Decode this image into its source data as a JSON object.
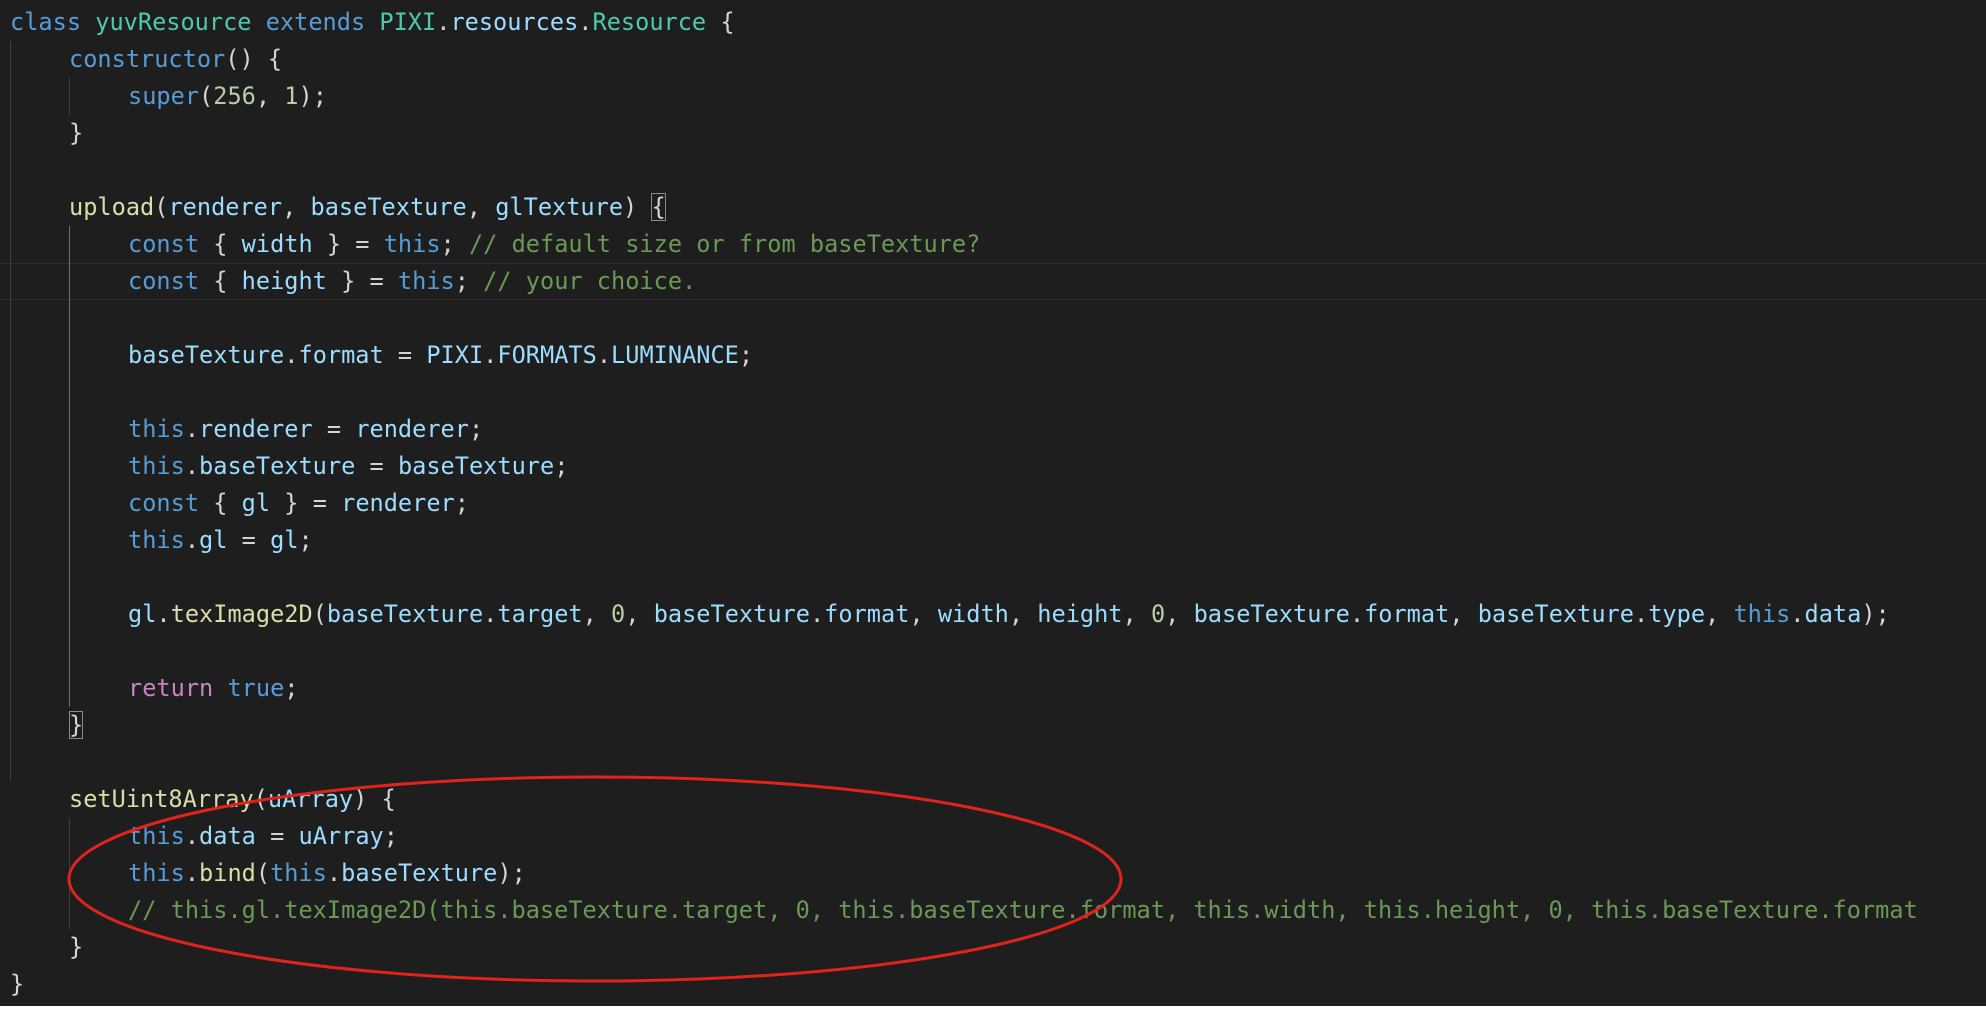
{
  "colors": {
    "background": "#1e1e1e",
    "keyword": "#569cd6",
    "class_name": "#4ec9b0",
    "function": "#dcdcaa",
    "variable": "#9cdcfe",
    "number": "#b5cea8",
    "comment": "#6a9955",
    "control": "#c586c0",
    "annotation": "#e0241b"
  },
  "code": {
    "lines": [
      {
        "indent": 0,
        "tokens": [
          {
            "t": "class",
            "c": "k"
          },
          {
            "t": " "
          },
          {
            "t": "yuvResource",
            "c": "c"
          },
          {
            "t": " "
          },
          {
            "t": "extends",
            "c": "k"
          },
          {
            "t": " "
          },
          {
            "t": "PIXI",
            "c": "c"
          },
          {
            "t": "."
          },
          {
            "t": "resources",
            "c": "v"
          },
          {
            "t": "."
          },
          {
            "t": "Resource",
            "c": "c"
          },
          {
            "t": " {"
          }
        ]
      },
      {
        "indent": 1,
        "tokens": [
          {
            "t": "constructor",
            "c": "k"
          },
          {
            "t": "() {"
          }
        ]
      },
      {
        "indent": 2,
        "tokens": [
          {
            "t": "super",
            "c": "k"
          },
          {
            "t": "("
          },
          {
            "t": "256",
            "c": "n"
          },
          {
            "t": ", "
          },
          {
            "t": "1",
            "c": "n"
          },
          {
            "t": ");"
          }
        ]
      },
      {
        "indent": 1,
        "tokens": [
          {
            "t": "}"
          }
        ]
      },
      {
        "indent": 0,
        "tokens": []
      },
      {
        "indent": 1,
        "tokens": [
          {
            "t": "upload",
            "c": "f"
          },
          {
            "t": "("
          },
          {
            "t": "renderer",
            "c": "v"
          },
          {
            "t": ", "
          },
          {
            "t": "baseTexture",
            "c": "v"
          },
          {
            "t": ", "
          },
          {
            "t": "glTexture",
            "c": "v"
          },
          {
            "t": ") "
          },
          {
            "t": "{",
            "c": "p bm"
          }
        ]
      },
      {
        "indent": 2,
        "tokens": [
          {
            "t": "const",
            "c": "k"
          },
          {
            "t": " { "
          },
          {
            "t": "width",
            "c": "v"
          },
          {
            "t": " } = "
          },
          {
            "t": "this",
            "c": "k"
          },
          {
            "t": "; "
          },
          {
            "t": "// default size or from baseTexture?",
            "c": "m"
          }
        ]
      },
      {
        "indent": 2,
        "current": true,
        "tokens": [
          {
            "t": "const",
            "c": "k"
          },
          {
            "t": " { "
          },
          {
            "t": "height",
            "c": "v"
          },
          {
            "t": " } = "
          },
          {
            "t": "this",
            "c": "k"
          },
          {
            "t": "; "
          },
          {
            "t": "// your choice.",
            "c": "m"
          }
        ]
      },
      {
        "indent": 0,
        "tokens": []
      },
      {
        "indent": 2,
        "tokens": [
          {
            "t": "baseTexture",
            "c": "v"
          },
          {
            "t": "."
          },
          {
            "t": "format",
            "c": "v"
          },
          {
            "t": " = "
          },
          {
            "t": "PIXI",
            "c": "v"
          },
          {
            "t": "."
          },
          {
            "t": "FORMATS",
            "c": "v"
          },
          {
            "t": "."
          },
          {
            "t": "LUMINANCE",
            "c": "v"
          },
          {
            "t": ";"
          }
        ]
      },
      {
        "indent": 0,
        "tokens": []
      },
      {
        "indent": 2,
        "tokens": [
          {
            "t": "this",
            "c": "k"
          },
          {
            "t": "."
          },
          {
            "t": "renderer",
            "c": "v"
          },
          {
            "t": " = "
          },
          {
            "t": "renderer",
            "c": "v"
          },
          {
            "t": ";"
          }
        ]
      },
      {
        "indent": 2,
        "tokens": [
          {
            "t": "this",
            "c": "k"
          },
          {
            "t": "."
          },
          {
            "t": "baseTexture",
            "c": "v"
          },
          {
            "t": " = "
          },
          {
            "t": "baseTexture",
            "c": "v"
          },
          {
            "t": ";"
          }
        ]
      },
      {
        "indent": 2,
        "tokens": [
          {
            "t": "const",
            "c": "k"
          },
          {
            "t": " { "
          },
          {
            "t": "gl",
            "c": "v"
          },
          {
            "t": " } = "
          },
          {
            "t": "renderer",
            "c": "v"
          },
          {
            "t": ";"
          }
        ]
      },
      {
        "indent": 2,
        "tokens": [
          {
            "t": "this",
            "c": "k"
          },
          {
            "t": "."
          },
          {
            "t": "gl",
            "c": "v"
          },
          {
            "t": " = "
          },
          {
            "t": "gl",
            "c": "v"
          },
          {
            "t": ";"
          }
        ]
      },
      {
        "indent": 0,
        "tokens": []
      },
      {
        "indent": 2,
        "tokens": [
          {
            "t": "gl",
            "c": "v"
          },
          {
            "t": "."
          },
          {
            "t": "texImage2D",
            "c": "f"
          },
          {
            "t": "("
          },
          {
            "t": "baseTexture",
            "c": "v"
          },
          {
            "t": "."
          },
          {
            "t": "target",
            "c": "v"
          },
          {
            "t": ", "
          },
          {
            "t": "0",
            "c": "n"
          },
          {
            "t": ", "
          },
          {
            "t": "baseTexture",
            "c": "v"
          },
          {
            "t": "."
          },
          {
            "t": "format",
            "c": "v"
          },
          {
            "t": ", "
          },
          {
            "t": "width",
            "c": "v"
          },
          {
            "t": ", "
          },
          {
            "t": "height",
            "c": "v"
          },
          {
            "t": ", "
          },
          {
            "t": "0",
            "c": "n"
          },
          {
            "t": ", "
          },
          {
            "t": "baseTexture",
            "c": "v"
          },
          {
            "t": "."
          },
          {
            "t": "format",
            "c": "v"
          },
          {
            "t": ", "
          },
          {
            "t": "baseTexture",
            "c": "v"
          },
          {
            "t": "."
          },
          {
            "t": "type",
            "c": "v"
          },
          {
            "t": ", "
          },
          {
            "t": "this",
            "c": "k"
          },
          {
            "t": "."
          },
          {
            "t": "data",
            "c": "v"
          },
          {
            "t": ");"
          }
        ]
      },
      {
        "indent": 0,
        "tokens": []
      },
      {
        "indent": 2,
        "tokens": [
          {
            "t": "return",
            "c": "r"
          },
          {
            "t": " "
          },
          {
            "t": "true",
            "c": "k"
          },
          {
            "t": ";"
          }
        ]
      },
      {
        "indent": 1,
        "tokens": [
          {
            "t": "}",
            "c": "p bm"
          }
        ]
      },
      {
        "indent": 0,
        "tokens": []
      },
      {
        "indent": 1,
        "tokens": [
          {
            "t": "setUint8Array",
            "c": "f"
          },
          {
            "t": "("
          },
          {
            "t": "uArray",
            "c": "v"
          },
          {
            "t": ") {"
          }
        ]
      },
      {
        "indent": 2,
        "tokens": [
          {
            "t": "this",
            "c": "k"
          },
          {
            "t": "."
          },
          {
            "t": "data",
            "c": "v"
          },
          {
            "t": " = "
          },
          {
            "t": "uArray",
            "c": "v"
          },
          {
            "t": ";"
          }
        ]
      },
      {
        "indent": 2,
        "tokens": [
          {
            "t": "this",
            "c": "k"
          },
          {
            "t": "."
          },
          {
            "t": "bind",
            "c": "f"
          },
          {
            "t": "("
          },
          {
            "t": "this",
            "c": "k"
          },
          {
            "t": "."
          },
          {
            "t": "baseTexture",
            "c": "v"
          },
          {
            "t": ");"
          }
        ]
      },
      {
        "indent": 2,
        "tokens": [
          {
            "t": "// this.gl.texImage2D(this.baseTexture.target, 0, this.baseTexture.format, this.width, this.height, 0, this.baseTexture.format",
            "c": "m"
          }
        ]
      },
      {
        "indent": 1,
        "tokens": [
          {
            "t": "}"
          }
        ]
      },
      {
        "indent": 0,
        "tokens": [
          {
            "t": "}"
          }
        ]
      }
    ]
  }
}
